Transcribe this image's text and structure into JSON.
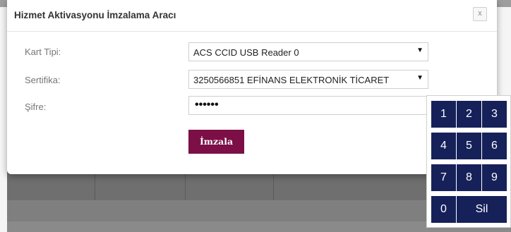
{
  "modal": {
    "title": "Hizmet Aktivasyonu İmzalama Aracı",
    "close_label": "x"
  },
  "form": {
    "card_type": {
      "label": "Kart Tipi:",
      "value": "ACS CCID USB Reader 0"
    },
    "certificate": {
      "label": "Sertifika:",
      "value": "3250566851 EFİNANS ELEKTRONİK TİCARET"
    },
    "password": {
      "label": "Şifre:",
      "value": "••••••"
    },
    "sign_button": "İmzala"
  },
  "keypad": {
    "keys": [
      "1",
      "2",
      "3",
      "4",
      "5",
      "6",
      "7",
      "8",
      "9",
      "0",
      "Sil"
    ]
  },
  "background": {
    "row_text": "...",
    "dropdown_arrow": "▼"
  },
  "colors": {
    "accent_button": "#7b0f46",
    "keypad_key": "#16215a"
  }
}
